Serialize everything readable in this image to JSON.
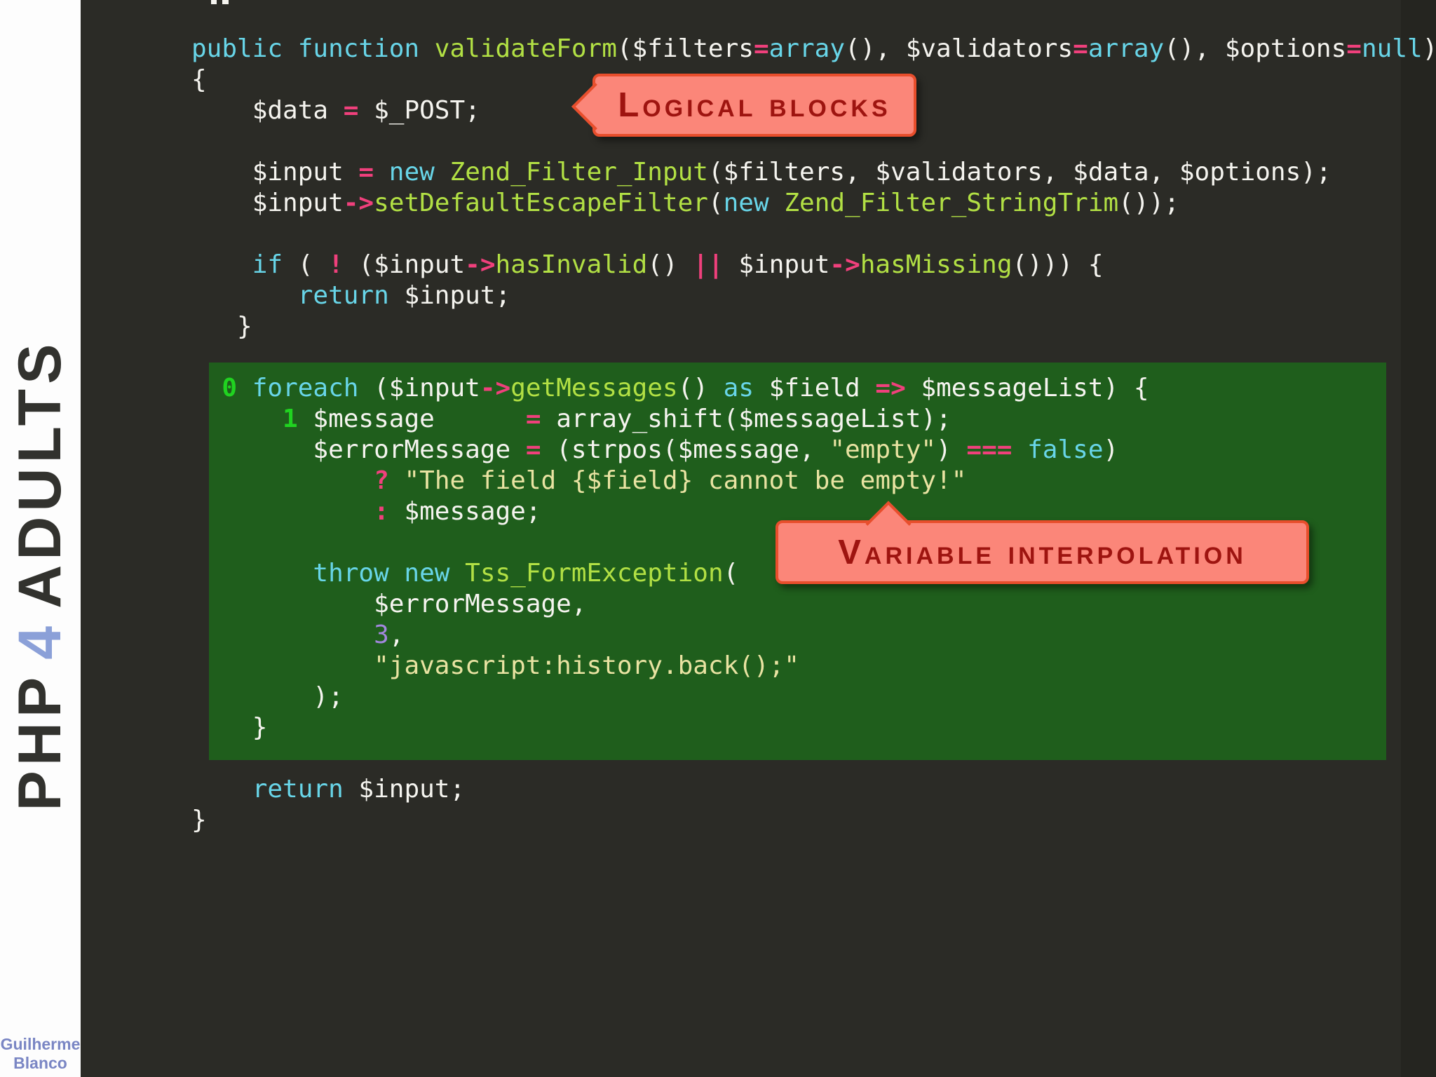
{
  "sidebar": {
    "title_php": "PHP",
    "title_num": "4",
    "title_adults": "ADULTS",
    "author_line1": "Guilherme",
    "author_line2": "Blanco"
  },
  "callouts": {
    "logical_blocks": "Logical blocks",
    "variable_interpolation": "Variable interpolation"
  },
  "colors": {
    "background": "#2b2b26",
    "sidebar_bg": "#fdfdfd",
    "sidebar_title": "#32322e",
    "sidebar_accent_4": "#8ba0d8",
    "author_text": "#7a86c4",
    "highlight_block": "#1f5e1c",
    "callout_fill": "#fb8679",
    "callout_border": "#e84e2c",
    "callout_text": "#9e1410",
    "code_keyword": "#68d5e8",
    "code_function": "#b2e044",
    "code_operator": "#f0407c",
    "code_string": "#e9e3a2",
    "code_number": "#a287dd",
    "code_plain": "#f5f4ef",
    "code_marker": "#20d320"
  },
  "code": {
    "lines": [
      [
        {
          "t": "public function ",
          "c": "kw"
        },
        {
          "t": "validateForm",
          "c": "fn"
        },
        {
          "t": "($filters",
          "c": "pl"
        },
        {
          "t": "=",
          "c": "op"
        },
        {
          "t": "array",
          "c": "kw"
        },
        {
          "t": "(), $validators",
          "c": "pl"
        },
        {
          "t": "=",
          "c": "op"
        },
        {
          "t": "array",
          "c": "kw"
        },
        {
          "t": "(), $options",
          "c": "pl"
        },
        {
          "t": "=",
          "c": "op"
        },
        {
          "t": "null",
          "c": "kw"
        },
        {
          "t": ")",
          "c": "pl"
        }
      ],
      [
        {
          "t": "{",
          "c": "pl"
        }
      ],
      [
        {
          "t": "    $data ",
          "c": "pl"
        },
        {
          "t": "=",
          "c": "op"
        },
        {
          "t": " $_POST;",
          "c": "pl"
        }
      ],
      [],
      [
        {
          "t": "    $input ",
          "c": "pl"
        },
        {
          "t": "=",
          "c": "op"
        },
        {
          "t": " ",
          "c": "pl"
        },
        {
          "t": "new",
          "c": "kw"
        },
        {
          "t": " ",
          "c": "pl"
        },
        {
          "t": "Zend_Filter_Input",
          "c": "fn"
        },
        {
          "t": "($filters, $validators, $data, $options);",
          "c": "pl"
        }
      ],
      [
        {
          "t": "    $input",
          "c": "pl"
        },
        {
          "t": "->",
          "c": "op"
        },
        {
          "t": "setDefaultEscapeFilter",
          "c": "fn"
        },
        {
          "t": "(",
          "c": "pl"
        },
        {
          "t": "new",
          "c": "kw"
        },
        {
          "t": " ",
          "c": "pl"
        },
        {
          "t": "Zend_Filter_StringTrim",
          "c": "fn"
        },
        {
          "t": "());",
          "c": "pl"
        }
      ],
      [],
      [
        {
          "t": "    ",
          "c": "pl"
        },
        {
          "t": "if",
          "c": "kw"
        },
        {
          "t": " ( ",
          "c": "pl"
        },
        {
          "t": "!",
          "c": "op"
        },
        {
          "t": " ($input",
          "c": "pl"
        },
        {
          "t": "->",
          "c": "op"
        },
        {
          "t": "hasInvalid",
          "c": "fn"
        },
        {
          "t": "() ",
          "c": "pl"
        },
        {
          "t": "||",
          "c": "op"
        },
        {
          "t": " $input",
          "c": "pl"
        },
        {
          "t": "->",
          "c": "op"
        },
        {
          "t": "hasMissing",
          "c": "fn"
        },
        {
          "t": "())) {",
          "c": "pl"
        }
      ],
      [
        {
          "t": "       ",
          "c": "pl"
        },
        {
          "t": "return",
          "c": "kw"
        },
        {
          "t": " $input;",
          "c": "pl"
        }
      ],
      [
        {
          "t": "   }",
          "c": "pl"
        }
      ],
      [],
      [
        {
          "t": "  ",
          "c": "pl"
        },
        {
          "t": "0",
          "c": "mk"
        },
        {
          "t": " ",
          "c": "pl"
        },
        {
          "t": "foreach",
          "c": "kw"
        },
        {
          "t": " ($input",
          "c": "pl"
        },
        {
          "t": "->",
          "c": "op"
        },
        {
          "t": "getMessages",
          "c": "fn"
        },
        {
          "t": "() ",
          "c": "pl"
        },
        {
          "t": "as",
          "c": "kw"
        },
        {
          "t": " $field ",
          "c": "pl"
        },
        {
          "t": "=>",
          "c": "op"
        },
        {
          "t": " $messageList) {",
          "c": "pl"
        }
      ],
      [
        {
          "t": "      ",
          "c": "pl"
        },
        {
          "t": "1",
          "c": "mk"
        },
        {
          "t": " $message      ",
          "c": "pl"
        },
        {
          "t": "=",
          "c": "op"
        },
        {
          "t": " array_shift($messageList);",
          "c": "pl"
        }
      ],
      [
        {
          "t": "        $errorMessage ",
          "c": "pl"
        },
        {
          "t": "=",
          "c": "op"
        },
        {
          "t": " (strpos($message, ",
          "c": "pl"
        },
        {
          "t": "\"empty\"",
          "c": "str"
        },
        {
          "t": ") ",
          "c": "pl"
        },
        {
          "t": "===",
          "c": "op"
        },
        {
          "t": " ",
          "c": "pl"
        },
        {
          "t": "false",
          "c": "kw"
        },
        {
          "t": ")",
          "c": "pl"
        }
      ],
      [
        {
          "t": "            ",
          "c": "pl"
        },
        {
          "t": "?",
          "c": "op"
        },
        {
          "t": " ",
          "c": "pl"
        },
        {
          "t": "\"The field {$field} cannot be empty!\"",
          "c": "str"
        }
      ],
      [
        {
          "t": "            ",
          "c": "pl"
        },
        {
          "t": ":",
          "c": "op"
        },
        {
          "t": " $message;",
          "c": "pl"
        }
      ],
      [],
      [
        {
          "t": "        ",
          "c": "pl"
        },
        {
          "t": "throw new",
          "c": "kw"
        },
        {
          "t": " ",
          "c": "pl"
        },
        {
          "t": "Tss_FormException",
          "c": "fn"
        },
        {
          "t": "(",
          "c": "pl"
        }
      ],
      [
        {
          "t": "            $errorMessage,",
          "c": "pl"
        }
      ],
      [
        {
          "t": "            ",
          "c": "pl"
        },
        {
          "t": "3",
          "c": "num"
        },
        {
          "t": ",",
          "c": "pl"
        }
      ],
      [
        {
          "t": "            ",
          "c": "pl"
        },
        {
          "t": "\"javascript:history.back();\"",
          "c": "str"
        }
      ],
      [
        {
          "t": "        );",
          "c": "pl"
        }
      ],
      [
        {
          "t": "    }",
          "c": "pl"
        }
      ],
      [],
      [
        {
          "t": "    ",
          "c": "pl"
        },
        {
          "t": "return",
          "c": "kw"
        },
        {
          "t": " $input;",
          "c": "pl"
        }
      ],
      [
        {
          "t": "}",
          "c": "pl"
        }
      ]
    ]
  }
}
